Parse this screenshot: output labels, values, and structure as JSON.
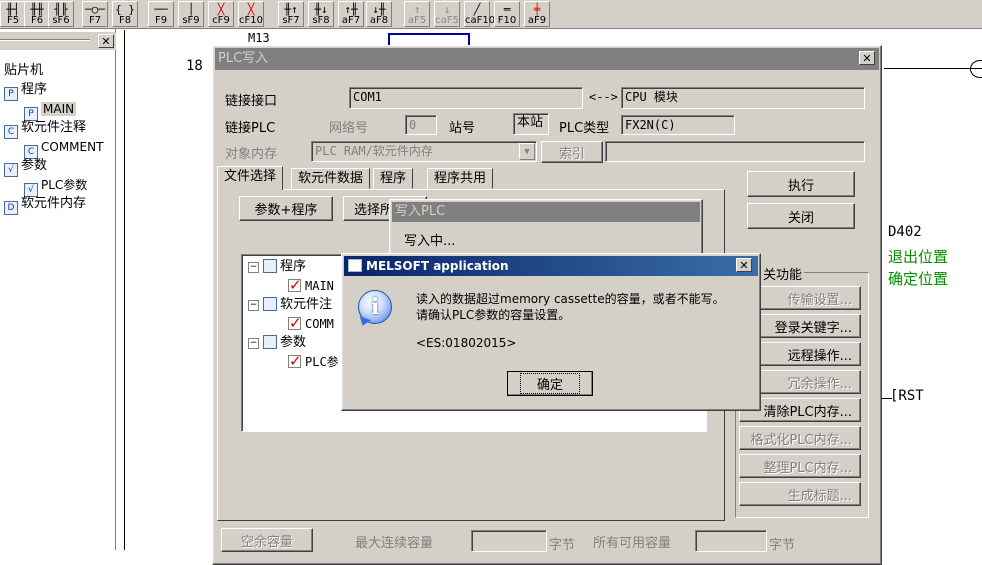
{
  "toolbar": {
    "buttons": [
      {
        "glyph": "╫┤",
        "key": "F5"
      },
      {
        "glyph": "╫╫",
        "key": "F6"
      },
      {
        "glyph": "╢╟",
        "key": "sF6"
      },
      {
        "glyph": "─○─",
        "key": "F7"
      },
      {
        "glyph": "{ }",
        "key": "F8"
      },
      {
        "glyph": "──",
        "key": "F9"
      },
      {
        "glyph": "│",
        "key": "sF9"
      },
      {
        "glyph": "╳",
        "key": "cF9"
      },
      {
        "glyph": "╳",
        "key": "cF10"
      },
      {
        "glyph": "╫↑",
        "key": "sF7"
      },
      {
        "glyph": "╫↓",
        "key": "sF8"
      },
      {
        "glyph": "↑╫",
        "key": "aF7"
      },
      {
        "glyph": "↓╫",
        "key": "aF8"
      },
      {
        "glyph": "↑",
        "key": "aF5"
      },
      {
        "glyph": "↓",
        "key": "caF5"
      },
      {
        "glyph": "╱",
        "key": "caF10"
      },
      {
        "glyph": "═",
        "key": "F10"
      },
      {
        "glyph": "╪",
        "key": "aF9"
      }
    ]
  },
  "tree": {
    "close": "✕",
    "items": [
      {
        "label": "贴片机",
        "level": 0,
        "icon": ""
      },
      {
        "label": "程序",
        "level": 0,
        "icon": "P"
      },
      {
        "label": "MAIN",
        "level": 1,
        "icon": "P"
      },
      {
        "label": "软元件注释",
        "level": 0,
        "icon": "C"
      },
      {
        "label": "COMMENT",
        "level": 1,
        "icon": "C"
      },
      {
        "label": "参数",
        "level": 0,
        "icon": "√"
      },
      {
        "label": "PLC参数",
        "level": 1,
        "icon": "√"
      },
      {
        "label": "软元件内存",
        "level": 0,
        "icon": "D"
      }
    ]
  },
  "ladder": {
    "step_num": "18",
    "m_label": "M13",
    "d_reg": "D402",
    "comment1": "退出位置",
    "comment2": "确定位置",
    "rst": "[RST"
  },
  "plc_write": {
    "title": "PLC写入",
    "close": "✕",
    "link_if_label": "链接接口",
    "link_if_value": "COM1",
    "arrow": "<-->",
    "cpu_value": "CPU 模块",
    "link_plc_label": "链接PLC",
    "network_label": "网络号",
    "network_value": "0",
    "station_label": "站号",
    "station_value": "本站",
    "plc_type_label": "PLC类型",
    "plc_type_value": "FX2N(C)",
    "target_mem_label": "对象内存",
    "target_mem_value": "PLC RAM/软元件内存",
    "index_button": "索引",
    "tabs": [
      "文件选择",
      "软元件数据",
      "程序",
      "程序共用"
    ],
    "param_prog_button": "参数+程序",
    "select_all_button": "选择所",
    "file_tree": [
      {
        "label": "程序",
        "level": 0
      },
      {
        "label": "MAIN",
        "level": 1
      },
      {
        "label": "软元件注",
        "level": 0
      },
      {
        "label": "COMM",
        "level": 1
      },
      {
        "label": "参数",
        "level": 0
      },
      {
        "label": "PLC参",
        "level": 1
      }
    ],
    "execute_button": "执行",
    "close_button": "关闭",
    "related_group": "关功能",
    "side_buttons": [
      {
        "label": "传输设置...",
        "enabled": false
      },
      {
        "label": "登录关键字...",
        "enabled": true
      },
      {
        "label": "远程操作...",
        "enabled": true
      },
      {
        "label": "冗余操作...",
        "enabled": false
      },
      {
        "label": "清除PLC内存...",
        "enabled": true
      },
      {
        "label": "格式化PLC内存...",
        "enabled": false
      },
      {
        "label": "整理PLC内存...",
        "enabled": false
      },
      {
        "label": "生成标题...",
        "enabled": false
      }
    ],
    "free_cap_button": "空余容量",
    "max_cont_label": "最大连续容量",
    "bytes1": "字节",
    "all_avail_label": "所有可用容量",
    "bytes2": "字节"
  },
  "writing": {
    "title": "写入PLC",
    "status": "写入中..."
  },
  "alert": {
    "title": "MELSOFT application",
    "close": "✕",
    "line1": "读入的数据超过memory cassette的容量，或者不能写。",
    "line2": "请确认PLC参数的容量设置。",
    "code": "<ES:01802015>",
    "ok": "确定",
    "info_glyph": "i"
  },
  "colors": {
    "title_active": "#0a246a",
    "title_inactive": "#808080",
    "face": "#d4d0c8",
    "ladder_green": "#009000"
  }
}
